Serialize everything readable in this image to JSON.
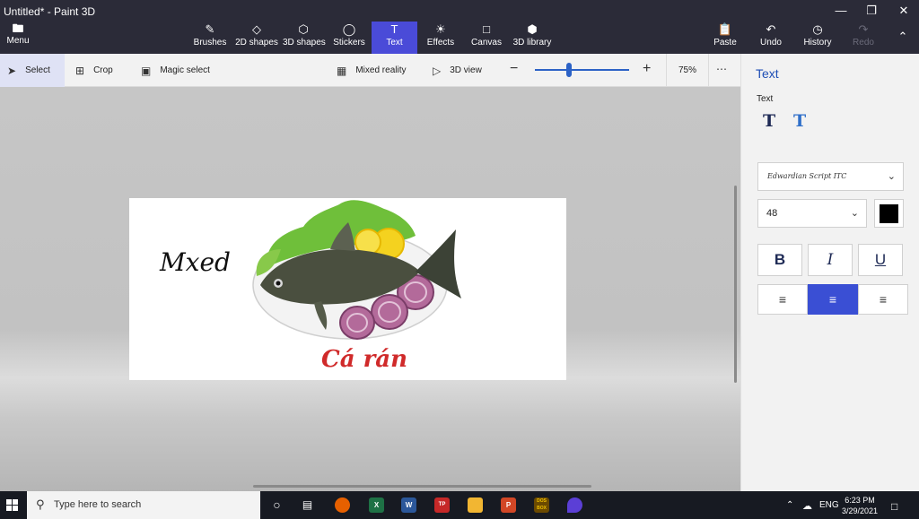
{
  "window": {
    "title": "Untitled* - Paint 3D"
  },
  "ribbon": {
    "menu_label": "Menu",
    "tools": [
      {
        "label": "Brushes"
      },
      {
        "label": "2D shapes"
      },
      {
        "label": "3D shapes"
      },
      {
        "label": "Stickers"
      },
      {
        "label": "Text"
      },
      {
        "label": "Effects"
      },
      {
        "label": "Canvas"
      },
      {
        "label": "3D library"
      }
    ],
    "right_tools": [
      {
        "label": "Paste"
      },
      {
        "label": "Undo"
      },
      {
        "label": "History"
      },
      {
        "label": "Redo"
      }
    ]
  },
  "toolbar": {
    "select_label": "Select",
    "crop_label": "Crop",
    "magic_select_label": "Magic select",
    "mixed_reality_label": "Mixed reality",
    "view_3d_label": "3D view",
    "zoom_value": "75%",
    "zoom_fraction": 0.36
  },
  "canvas": {
    "text_object": "Mxed",
    "title_text": "Cá rán"
  },
  "panel": {
    "heading": "Text",
    "sub_label": "Text",
    "font_name": "Edwardian Script ITC",
    "font_size": "48",
    "text_color": "#000000",
    "format": {
      "bold": "B",
      "italic": "I",
      "underline": "U"
    },
    "alignment": "center"
  },
  "taskbar": {
    "search_placeholder": "Type here to search",
    "language": "ENG",
    "time": "6:23 PM",
    "date": "3/29/2021",
    "app_badges": {
      "word": "W",
      "excel": "X",
      "powerpoint": "P",
      "dosbox": "DOS BOX",
      "tp": "TP"
    }
  },
  "colors": {
    "accent": "#4a4bd8",
    "titlebar": "#2b2b38",
    "panel_heading": "#1f4fb5",
    "canvas_title": "#d02a2a"
  }
}
